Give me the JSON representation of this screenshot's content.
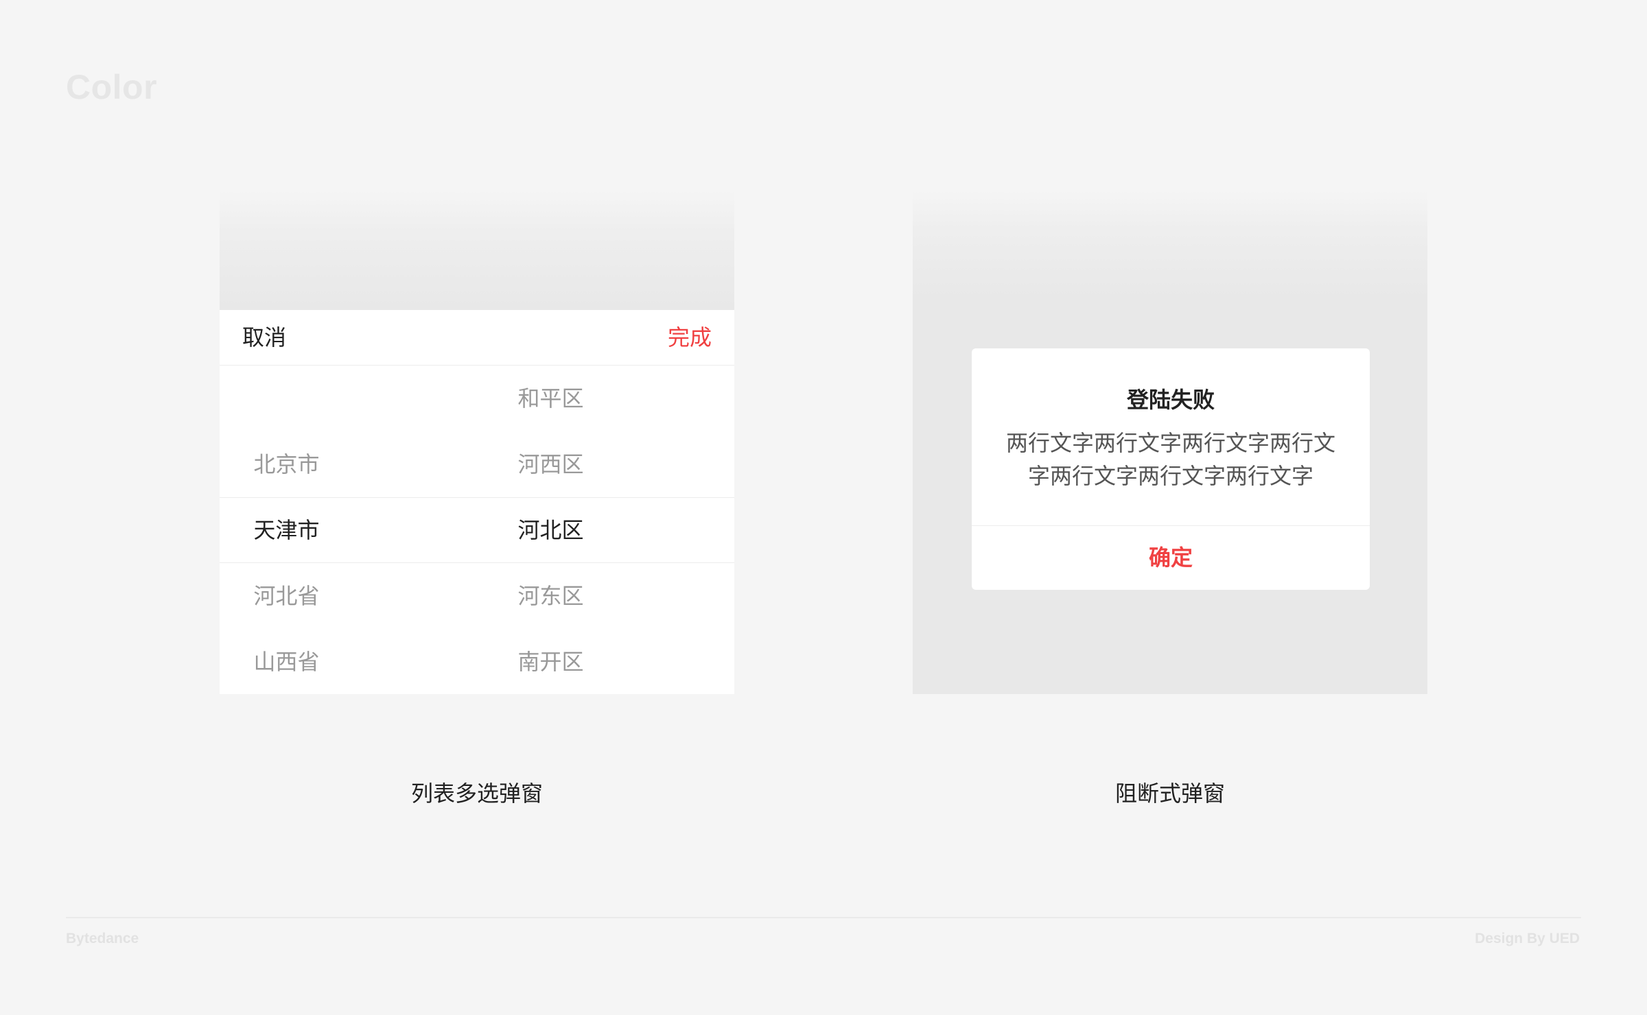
{
  "page": {
    "heading": "Color"
  },
  "picker": {
    "cancel_label": "取消",
    "done_label": "完成",
    "done_color": "#f04142",
    "provinces": [
      {
        "label": ""
      },
      {
        "label": "北京市"
      },
      {
        "label": "天津市",
        "selected": true
      },
      {
        "label": "河北省"
      },
      {
        "label": "山西省"
      }
    ],
    "districts": [
      {
        "label": "和平区"
      },
      {
        "label": "河西区"
      },
      {
        "label": "河北区",
        "selected": true
      },
      {
        "label": "河东区"
      },
      {
        "label": "南开区"
      }
    ],
    "caption": "列表多选弹窗"
  },
  "dialog": {
    "title": "登陆失败",
    "message": "两行文字两行文字两行文字两行文字两行文字两行文字两行文字",
    "confirm_label": "确定",
    "confirm_color": "#f04142",
    "caption": "阻断式弹窗"
  },
  "footer": {
    "left": "Bytedance",
    "right": "Design By UED"
  }
}
